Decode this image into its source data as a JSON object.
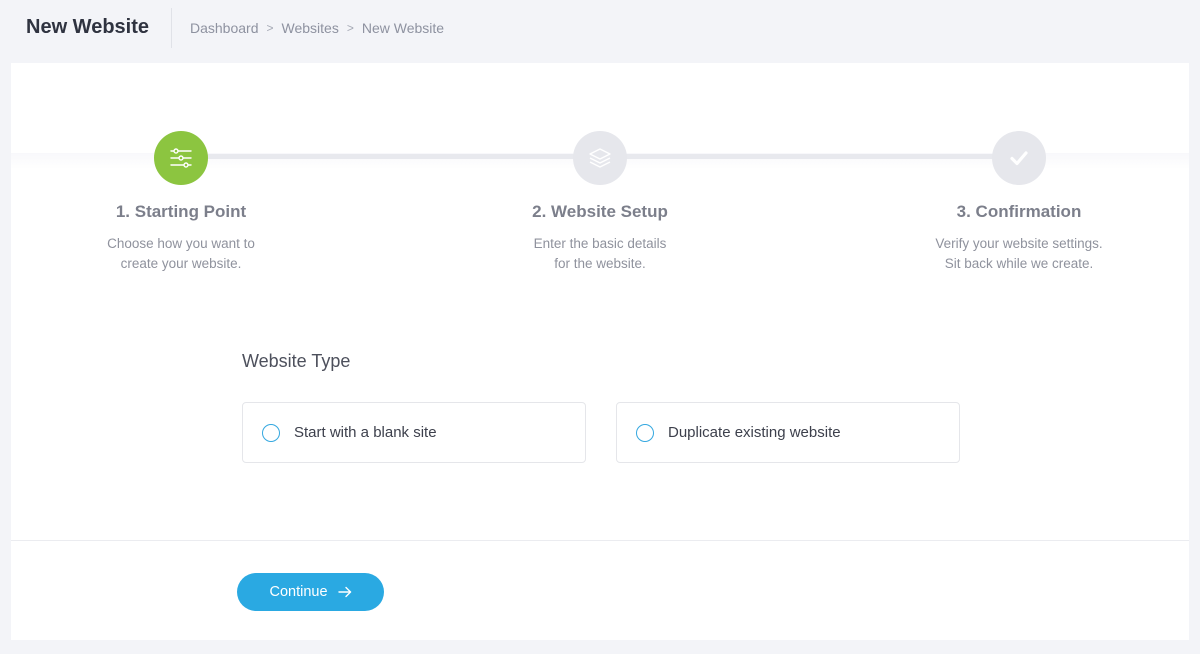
{
  "header": {
    "title": "New Website",
    "breadcrumb": [
      "Dashboard",
      "Websites",
      "New Website"
    ]
  },
  "steps": [
    {
      "title": "1. Starting Point",
      "desc": [
        "Choose how you want to",
        "create your website."
      ],
      "state": "active",
      "icon": "sliders-icon"
    },
    {
      "title": "2. Website Setup",
      "desc": [
        "Enter the basic details",
        "for the website."
      ],
      "state": "inactive",
      "icon": "layers-icon"
    },
    {
      "title": "3. Confirmation",
      "desc": [
        "Verify your website settings.",
        "Sit back while we create."
      ],
      "state": "inactive",
      "icon": "checkmark-icon"
    }
  ],
  "website_type": {
    "title": "Website Type",
    "options": [
      {
        "label": "Start with a blank site",
        "selected": false
      },
      {
        "label": "Duplicate existing website",
        "selected": false
      }
    ]
  },
  "actions": {
    "continue_label": "Continue",
    "continue_icon": "arrow-right-icon"
  },
  "colors": {
    "active_step": "#8cc540",
    "inactive_step": "#e6e7ec",
    "accent": "#2aa9e2",
    "radio_border": "#35a8e0"
  }
}
